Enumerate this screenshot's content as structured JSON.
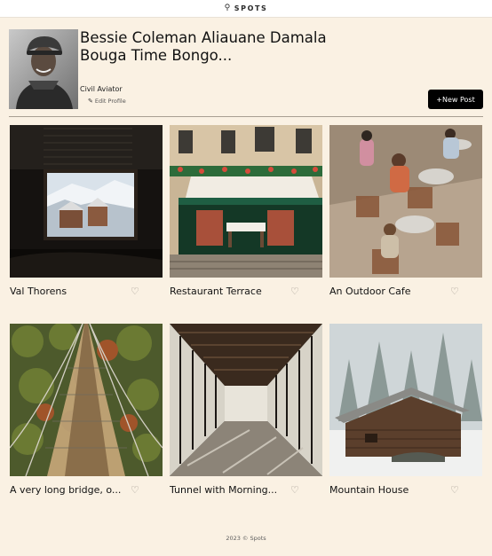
{
  "header": {
    "logo_text": "SPOTS",
    "logo_icon": "spots-logo-icon"
  },
  "profile": {
    "name": "Bessie Coleman Aliauane Damala Bouga Time Bongo...",
    "description": "Civil Aviator",
    "edit_label": "Edit Profile",
    "new_post_label": "+New Post"
  },
  "cards": [
    {
      "title": "Val Thorens",
      "liked": false
    },
    {
      "title": "Restaurant Terrace",
      "liked": false
    },
    {
      "title": "An Outdoor Cafe",
      "liked": false
    },
    {
      "title": "A very long bridge, o...",
      "liked": false
    },
    {
      "title": "Tunnel with Morning...",
      "liked": false
    },
    {
      "title": "Mountain House",
      "liked": false
    }
  ],
  "icons": {
    "like": "heart-icon",
    "edit": "pencil-icon"
  },
  "footer": {
    "text": "2023 © Spots"
  },
  "colors": {
    "background": "#faf1e3",
    "button": "#000000",
    "divider": "#a89f92"
  }
}
